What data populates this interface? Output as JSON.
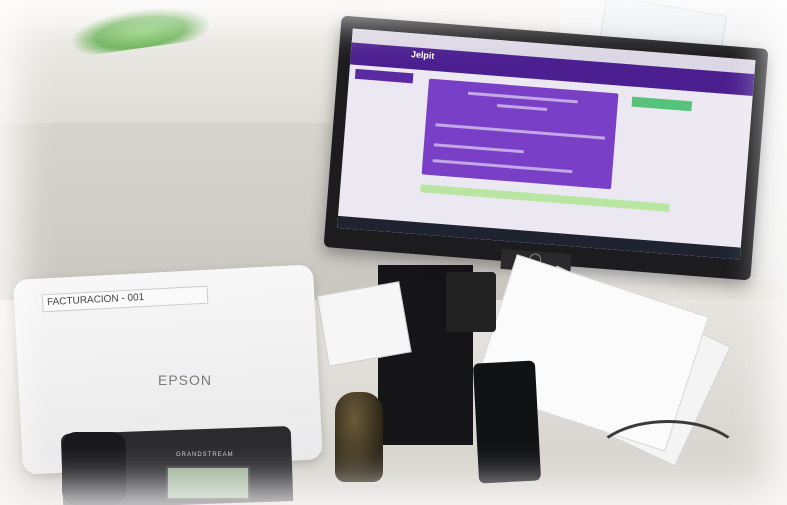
{
  "scene": {
    "scanner_label": "FACTURACION - 001",
    "scanner_brand": "EPSON",
    "phone_brand": "GRANDSTREAM",
    "screen_app_logo": "Jelpit"
  },
  "colors": {
    "app_header": "#4b1f8f",
    "app_card": "#7a3fc7",
    "app_green": "#57c27a"
  }
}
